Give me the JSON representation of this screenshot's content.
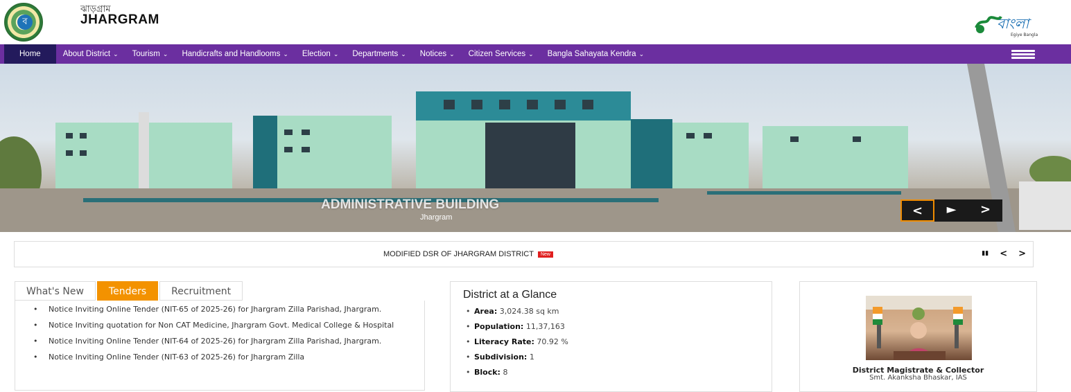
{
  "header": {
    "brand_sub": "ঝাড়গ্রাম",
    "brand_title": "JHARGRAM",
    "emblem_letter": "ব",
    "bangla_logo_text": "বাংলা",
    "bangla_logo_sub": "Egiye Bangla"
  },
  "nav": {
    "items": [
      {
        "label": "Home",
        "dropdown": false
      },
      {
        "label": "About District",
        "dropdown": true
      },
      {
        "label": "Tourism",
        "dropdown": true
      },
      {
        "label": "Handicrafts and Handlooms",
        "dropdown": true
      },
      {
        "label": "Election",
        "dropdown": true
      },
      {
        "label": "Departments",
        "dropdown": true
      },
      {
        "label": "Notices",
        "dropdown": true
      },
      {
        "label": "Citizen Services",
        "dropdown": true
      },
      {
        "label": "Bangla Sahayata Kendra",
        "dropdown": true
      }
    ],
    "chevron": "⌄"
  },
  "banner": {
    "caption": "ADMINISTRATIVE BUILDING",
    "subcaption": "Jhargram",
    "prev": "<",
    "play": "►",
    "next": ">"
  },
  "ticker": {
    "text": "MODIFIED DSR OF JHARGRAM DISTRICT",
    "badge": "New",
    "pause": "▮▮",
    "prev": "<",
    "next": ">"
  },
  "tabs": {
    "labels": [
      "What's New",
      "Tenders",
      "Recruitment"
    ],
    "active": 1,
    "items": [
      "Notice Inviting Online Tender (NIT-65 of 2025-26) for Jhargram Zilla Parishad, Jhargram.",
      "Notice Inviting quotation for Non CAT Medicine, Jhargram Govt. Medical College & Hospital",
      "Notice Inviting Online Tender (NIT-64 of 2025-26) for Jhargram Zilla Parishad, Jhargram.",
      "Notice Inviting Online Tender (NIT-63 of 2025-26) for Jhargram Zilla"
    ]
  },
  "glance": {
    "title": "District at a Glance",
    "rows": [
      {
        "label": "Area:",
        "value": "3,024.38 sq km"
      },
      {
        "label": "Population:",
        "value": "11,37,163"
      },
      {
        "label": "Literacy Rate:",
        "value": "70.92 %"
      },
      {
        "label": "Subdivision:",
        "value": "1"
      },
      {
        "label": "Block:",
        "value": "8"
      }
    ]
  },
  "dm": {
    "title": "District Magistrate & Collector",
    "name": "Smt. Akanksha Bhaskar, IAS"
  },
  "colors": {
    "nav_bg": "#6b2fa0",
    "nav_active": "#231a5c",
    "tab_active": "#f39200",
    "badge": "#e01f1f"
  }
}
